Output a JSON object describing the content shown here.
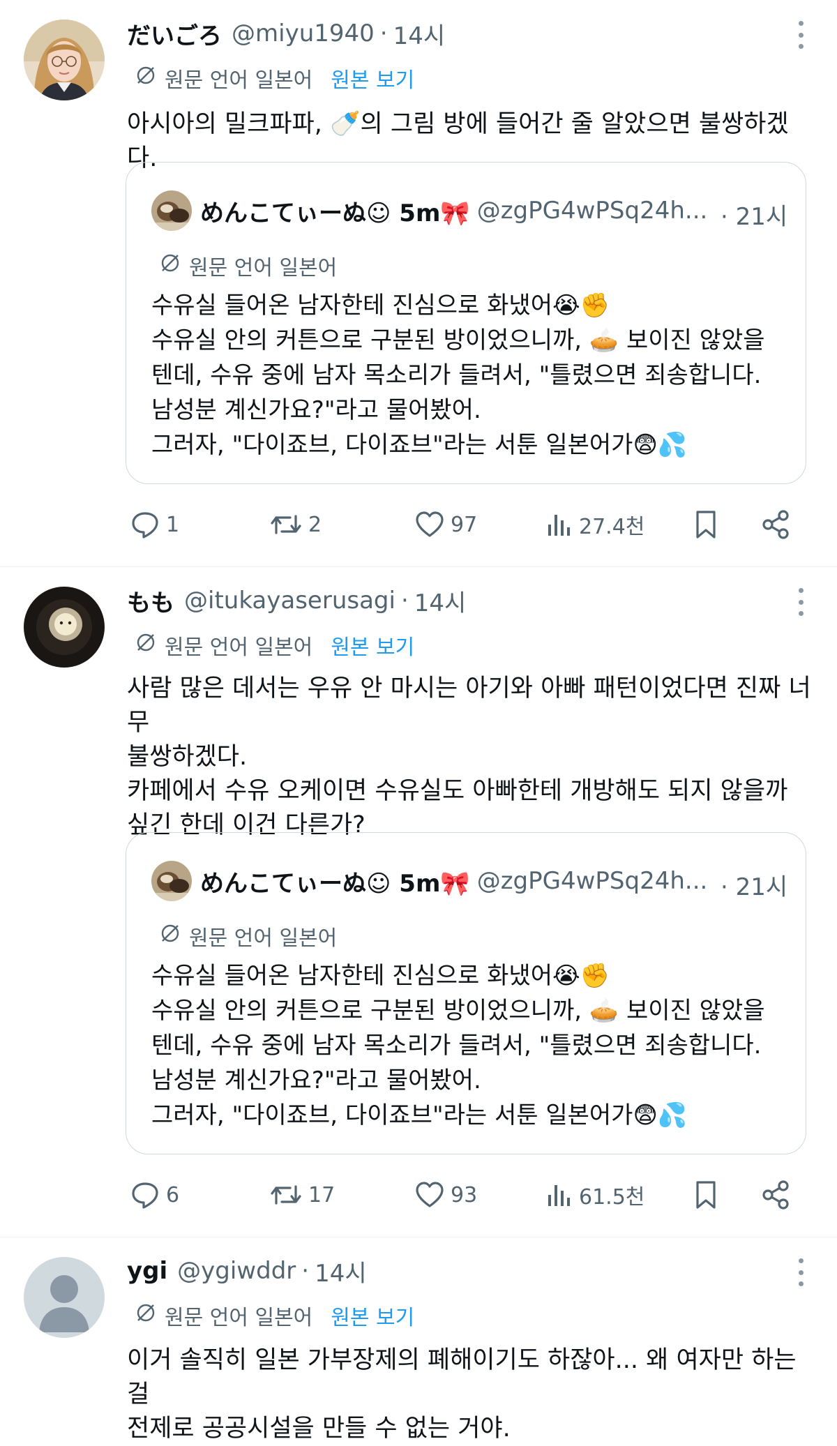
{
  "tweets": [
    {
      "name": "だいごろ",
      "handle": "@miyu1940",
      "dot": "·",
      "time": "14시",
      "translate_label": "원문 언어 일본어",
      "view_original": "원본 보기",
      "body": [
        "아시아의 밀크파파, 🍼의 그림 방에 들어간 줄 알았으면 불쌍하겠다."
      ],
      "quote": {
        "name": "めんこてぃーぬ☺︎ 5m🎀",
        "handle": "@zgPG4wPSq24h...",
        "time": "· 21시",
        "translate_label": "원문 언어 일본어",
        "body": [
          "수유실 들어온 남자한테 진심으로 화냈어😭✊",
          "수유실 안의 커튼으로 구분된 방이었으니까, 🥧 보이진 않았을",
          "텐데, 수유 중에 남자 목소리가 들려서, \"틀렸으면 죄송합니다.",
          "남성분 계신가요?\"라고 물어봤어.",
          "그러자, \"다이죠브, 다이죠브\"라는 서툰 일본어가😨💦"
        ]
      },
      "stats": {
        "replies": "1",
        "retweets": "2",
        "likes": "97",
        "views": "27.4천"
      }
    },
    {
      "name": "もも",
      "handle": "@itukayaserusagi",
      "dot": "·",
      "time": "14시",
      "translate_label": "원문 언어 일본어",
      "view_original": "원본 보기",
      "body": [
        "사람 많은 데서는 우유 안 마시는 아기와 아빠 패턴이었다면 진짜 너무",
        "불쌍하겠다.",
        "카페에서 수유 오케이면 수유실도 아빠한테 개방해도 되지 않을까",
        "싶긴 한데 이건 다른가?"
      ],
      "quote": {
        "name": "めんこてぃーぬ☺︎ 5m🎀",
        "handle": "@zgPG4wPSq24h...",
        "time": "· 21시",
        "translate_label": "원문 언어 일본어",
        "body": [
          "수유실 들어온 남자한테 진심으로 화냈어😭✊",
          "수유실 안의 커튼으로 구분된 방이었으니까, 🥧 보이진 않았을",
          "텐데, 수유 중에 남자 목소리가 들려서, \"틀렸으면 죄송합니다.",
          "남성분 계신가요?\"라고 물어봤어.",
          "그러자, \"다이죠브, 다이죠브\"라는 서툰 일본어가😨💦"
        ]
      },
      "stats": {
        "replies": "6",
        "retweets": "17",
        "likes": "93",
        "views": "61.5천"
      }
    },
    {
      "name": "ygi",
      "handle": "@ygiwddr",
      "dot": "·",
      "time": "14시",
      "translate_label": "원문 언어 일본어",
      "view_original": "원본 보기",
      "body": [
        "이거 솔직히 일본 가부장제의 폐해이기도 하잖아... 왜 여자만 하는 걸",
        "전제로 공공시설을 만들 수 없는 거야."
      ]
    }
  ],
  "colors": {
    "secondary_text": "#536471",
    "link": "#1d9bf0",
    "border": "#cfd9de",
    "divider": "#eff3f4"
  },
  "icons": [
    "translate-icon",
    "reply-icon",
    "retweet-icon",
    "like-icon",
    "views-icon",
    "bookmark-icon",
    "share-icon",
    "more-icon"
  ]
}
